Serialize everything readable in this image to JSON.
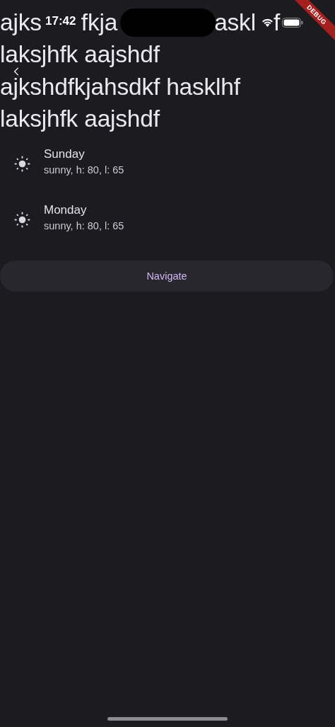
{
  "status_bar": {
    "time": "17:42"
  },
  "debug_banner": "DEBUG",
  "title": {
    "first_line_fragments": [
      "ajks",
      "fkja",
      "askl",
      "f"
    ],
    "lines": [
      "laksjhfk aajshdf",
      "ajkshdfkjahsdkf hasklhf",
      "laksjhfk aajshdf"
    ]
  },
  "forecast": [
    {
      "day": "Sunday",
      "summary": "sunny, h: 80, l: 65"
    },
    {
      "day": "Monday",
      "summary": "sunny, h: 80, l: 65"
    }
  ],
  "button": "Navigate"
}
